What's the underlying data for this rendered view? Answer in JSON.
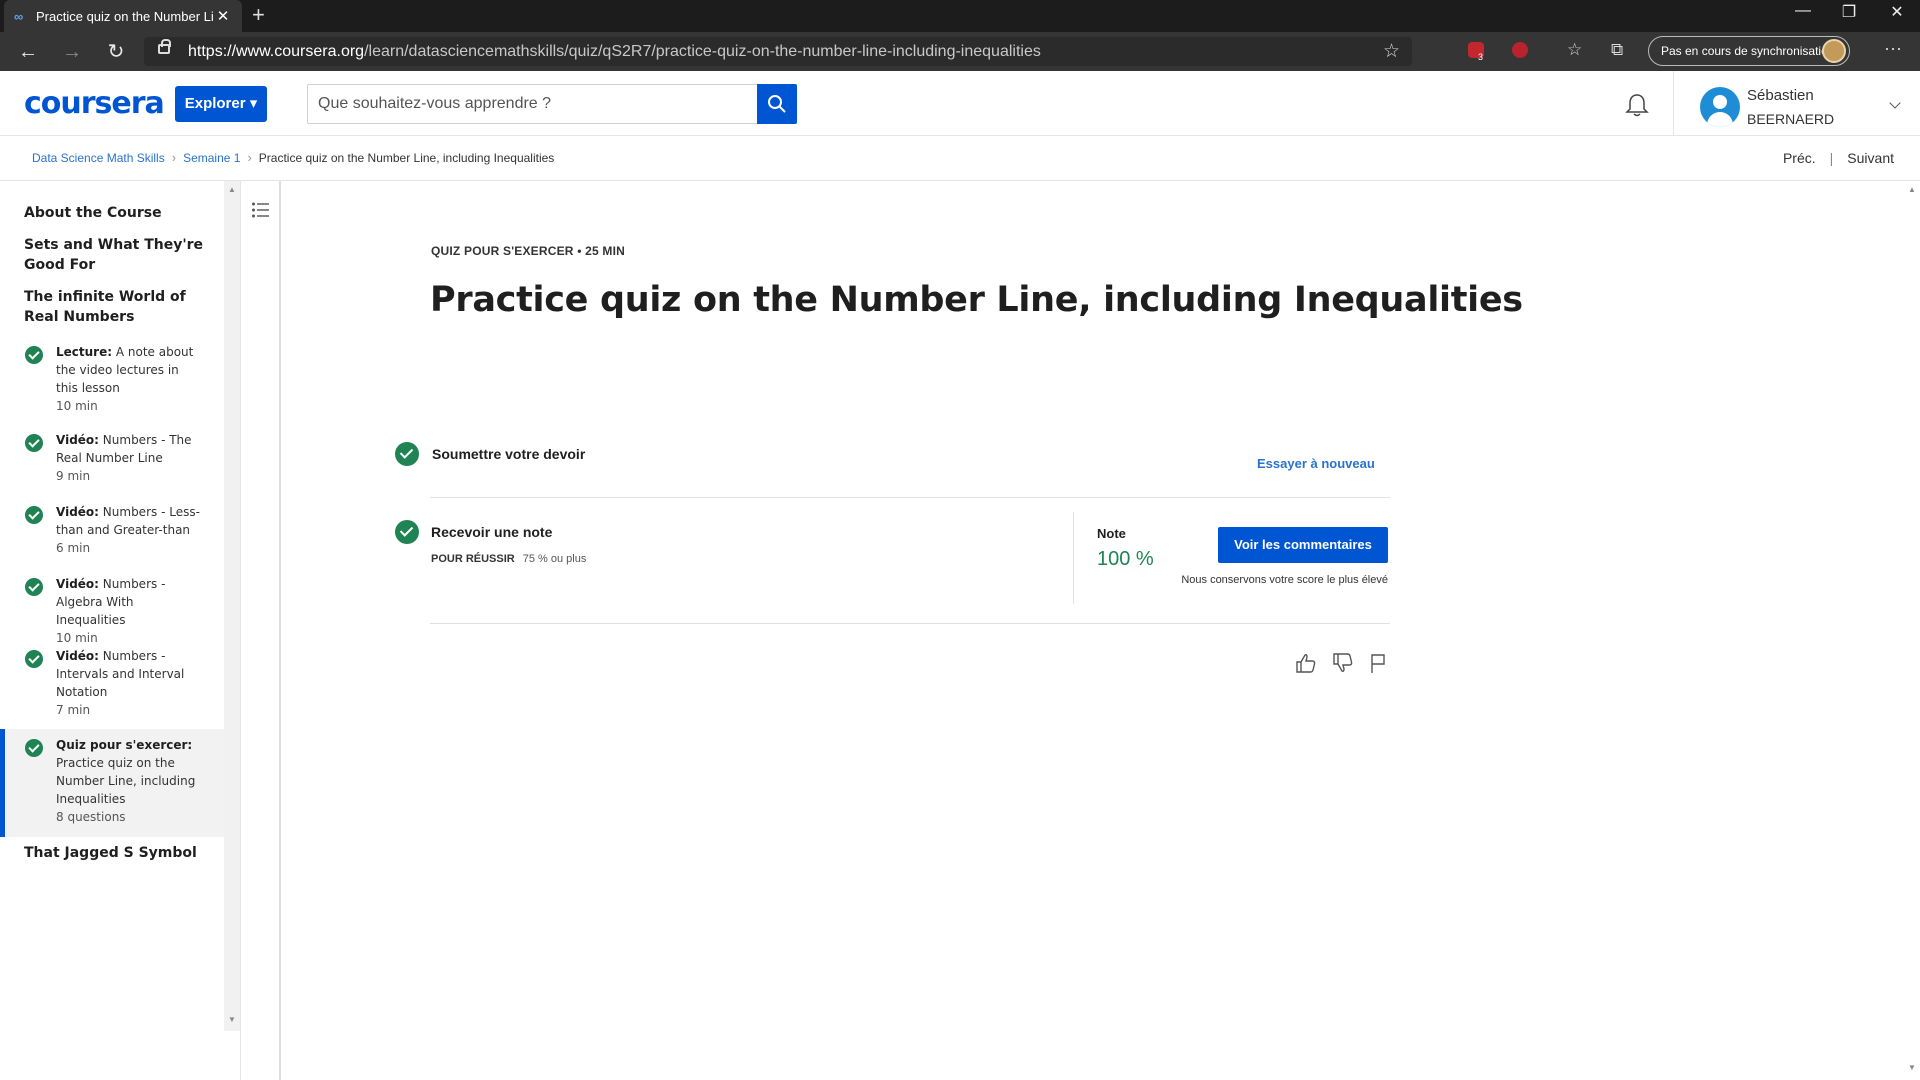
{
  "browser": {
    "tab_title": "Practice quiz on the Number Line, including Inequalities",
    "tab_favicon": "∞",
    "url_host": "https://www.coursera.org",
    "url_path": "/learn/datasciencemathskills/quiz/qS2R7/practice-quiz-on-the-number-line-including-inequalities",
    "sync_label": "Pas en cours de synchronisation",
    "extension_badge": "3"
  },
  "header": {
    "logo": "coursera",
    "explore_label": "Explorer",
    "search_placeholder": "Que souhaitez-vous apprendre ?",
    "user_first": "Sébastien",
    "user_last": "BEERNAERD"
  },
  "breadcrumb": {
    "items": [
      "Data Science Math Skills",
      "Semaine 1"
    ],
    "current": "Practice quiz on the Number Line, including Inequalities",
    "prev": "Préc.",
    "next": "Suivant"
  },
  "sidebar": {
    "sections": [
      "About the Course",
      "Sets and What They're Good For",
      "The infinite World of Real Numbers",
      "That Jagged S Symbol"
    ],
    "items": [
      {
        "type": "Lecture:",
        "title": "A note about the video lectures in this lesson",
        "meta": "10  min"
      },
      {
        "type": "Vidéo:",
        "title": "Numbers - The Real Number Line",
        "meta": "9  min"
      },
      {
        "type": "Vidéo:",
        "title": "Numbers - Less-than and Greater-than",
        "meta": "6  min"
      },
      {
        "type": "Vidéo:",
        "title": "Numbers - Algebra With Inequalities",
        "meta": "10  min"
      },
      {
        "type": "Vidéo:",
        "title": "Numbers - Intervals and Interval Notation",
        "meta": "7  min"
      },
      {
        "type": "Quiz pour s'exercer:",
        "title": "Practice quiz on the Number Line, including Inequalities",
        "meta": "8 questions"
      }
    ]
  },
  "main": {
    "kicker": "QUIZ POUR S'EXERCER • 25  MIN",
    "title": "Practice quiz on the Number Line, including Inequalities",
    "step1_label": "Soumettre votre devoir",
    "retry_label": "Essayer à nouveau",
    "step2_label": "Recevoir une note",
    "pass_label": "POUR RÉUSSIR",
    "pass_value": "75 % ou plus",
    "grade_label": "Note",
    "grade_value": "100 %",
    "feedback_button": "Voir les commentaires",
    "keep_note": "Nous conservons votre score le plus élevé"
  },
  "colors": {
    "brand": "#0056d2",
    "success": "#1f8354",
    "link": "#2a73cc"
  },
  "icons": [
    "like-icon",
    "dislike-icon",
    "flag-icon",
    "bell-icon",
    "search-icon",
    "toc-list-icon"
  ]
}
